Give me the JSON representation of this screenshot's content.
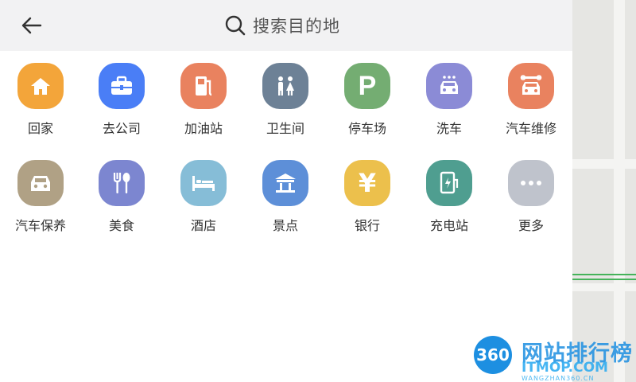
{
  "search": {
    "placeholder": "搜索目的地"
  },
  "categories": [
    {
      "label": "回家",
      "icon": "home-icon",
      "color": "#f3a53a"
    },
    {
      "label": "去公司",
      "icon": "briefcase-icon",
      "color": "#4a7ef6"
    },
    {
      "label": "加油站",
      "icon": "gas-pump-icon",
      "color": "#e9825f"
    },
    {
      "label": "卫生间",
      "icon": "restroom-icon",
      "color": "#6d8196"
    },
    {
      "label": "停车场",
      "icon": "parking-icon",
      "color": "#74ad72"
    },
    {
      "label": "洗车",
      "icon": "car-wash-icon",
      "color": "#8b8bd6"
    },
    {
      "label": "汽车维修",
      "icon": "car-repair-icon",
      "color": "#e9825f"
    },
    {
      "label": "汽车保养",
      "icon": "car-icon",
      "color": "#b0a185"
    },
    {
      "label": "美食",
      "icon": "fork-spoon-icon",
      "color": "#7c86d0"
    },
    {
      "label": "酒店",
      "icon": "bed-icon",
      "color": "#86bdd7"
    },
    {
      "label": "景点",
      "icon": "landmark-icon",
      "color": "#5d8fd8"
    },
    {
      "label": "银行",
      "icon": "yen-icon",
      "color": "#ecc04c"
    },
    {
      "label": "充电站",
      "icon": "charging-station-icon",
      "color": "#4f9e90"
    },
    {
      "label": "更多",
      "icon": "more-dots-icon",
      "color": "#bfc3cc"
    }
  ],
  "watermark": {
    "badge": "360",
    "title": "网站排行榜",
    "site": "ITMOP.COM",
    "sub": "WANGZHAN360.CN"
  }
}
